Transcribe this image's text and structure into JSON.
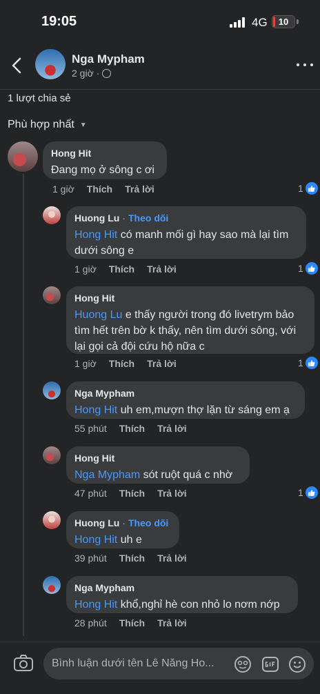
{
  "status": {
    "time": "19:05",
    "network": "4G",
    "battery": "10"
  },
  "header": {
    "name": "Nga Mypham",
    "meta": "2 giờ ·"
  },
  "shares": "1 lượt chia sẻ",
  "sort": "Phù hợp nhất",
  "comments": [
    {
      "author": "Hong Hit",
      "follow": "",
      "mention": "",
      "text": "Đang mọ ở sông c ơi",
      "time": "1 giờ",
      "like": "Thích",
      "reply": "Trả lời",
      "reactions": "1"
    },
    {
      "author": "Huong Lu",
      "follow": "Theo dõi",
      "mention": "Hong Hit",
      "text": " có manh mối gì hay sao mà lại tìm dưới sông e",
      "time": "1 giờ",
      "like": "Thích",
      "reply": "Trả lời",
      "reactions": "1"
    },
    {
      "author": "Hong Hit",
      "follow": "",
      "mention": "Huong Lu",
      "text": " e thấy người trong đó livetrym bảo tìm hết trên bờ k thấy, nên tìm dưới sông, với lại gọi cả đội cứu hộ nữa c",
      "time": "1 giờ",
      "like": "Thích",
      "reply": "Trả lời",
      "reactions": "1"
    },
    {
      "author": "Nga Mypham",
      "follow": "",
      "mention": "Hong Hit",
      "text": " uh em,mượn thợ lặn từ sáng em ạ",
      "time": "55 phút",
      "like": "Thích",
      "reply": "Trả lời",
      "reactions": ""
    },
    {
      "author": "Hong Hit",
      "follow": "",
      "mention": "Nga Mypham",
      "text": " sót ruột quá c nhờ",
      "time": "47 phút",
      "like": "Thích",
      "reply": "Trả lời",
      "reactions": "1"
    },
    {
      "author": "Huong Lu",
      "follow": "Theo dõi",
      "mention": "Hong Hit",
      "text": " uh e",
      "time": "39 phút",
      "like": "Thích",
      "reply": "Trả lời",
      "reactions": ""
    },
    {
      "author": "Nga Mypham",
      "follow": "",
      "mention": "Hong Hit",
      "text": " khổ,nghỉ hè con nhỏ lo nơm nớp",
      "time": "28 phút",
      "like": "Thích",
      "reply": "Trả lời",
      "reactions": ""
    }
  ],
  "composer": {
    "placeholder": "Bình luận dưới tên Lê Năng Ho..."
  },
  "icons": {
    "back": "chevron-left-icon",
    "more": "more-horizontal-icon",
    "camera": "camera-icon",
    "sticker": "sticker-icon",
    "gif": "gif-icon",
    "emoji": "emoji-icon",
    "like": "thumbs-up-icon",
    "globe": "globe-icon"
  },
  "colors": {
    "background": "#232425",
    "bubble": "#3a3b3c",
    "accent": "#4599ff",
    "like": "#2d88ff",
    "battery": "#e0463f"
  }
}
